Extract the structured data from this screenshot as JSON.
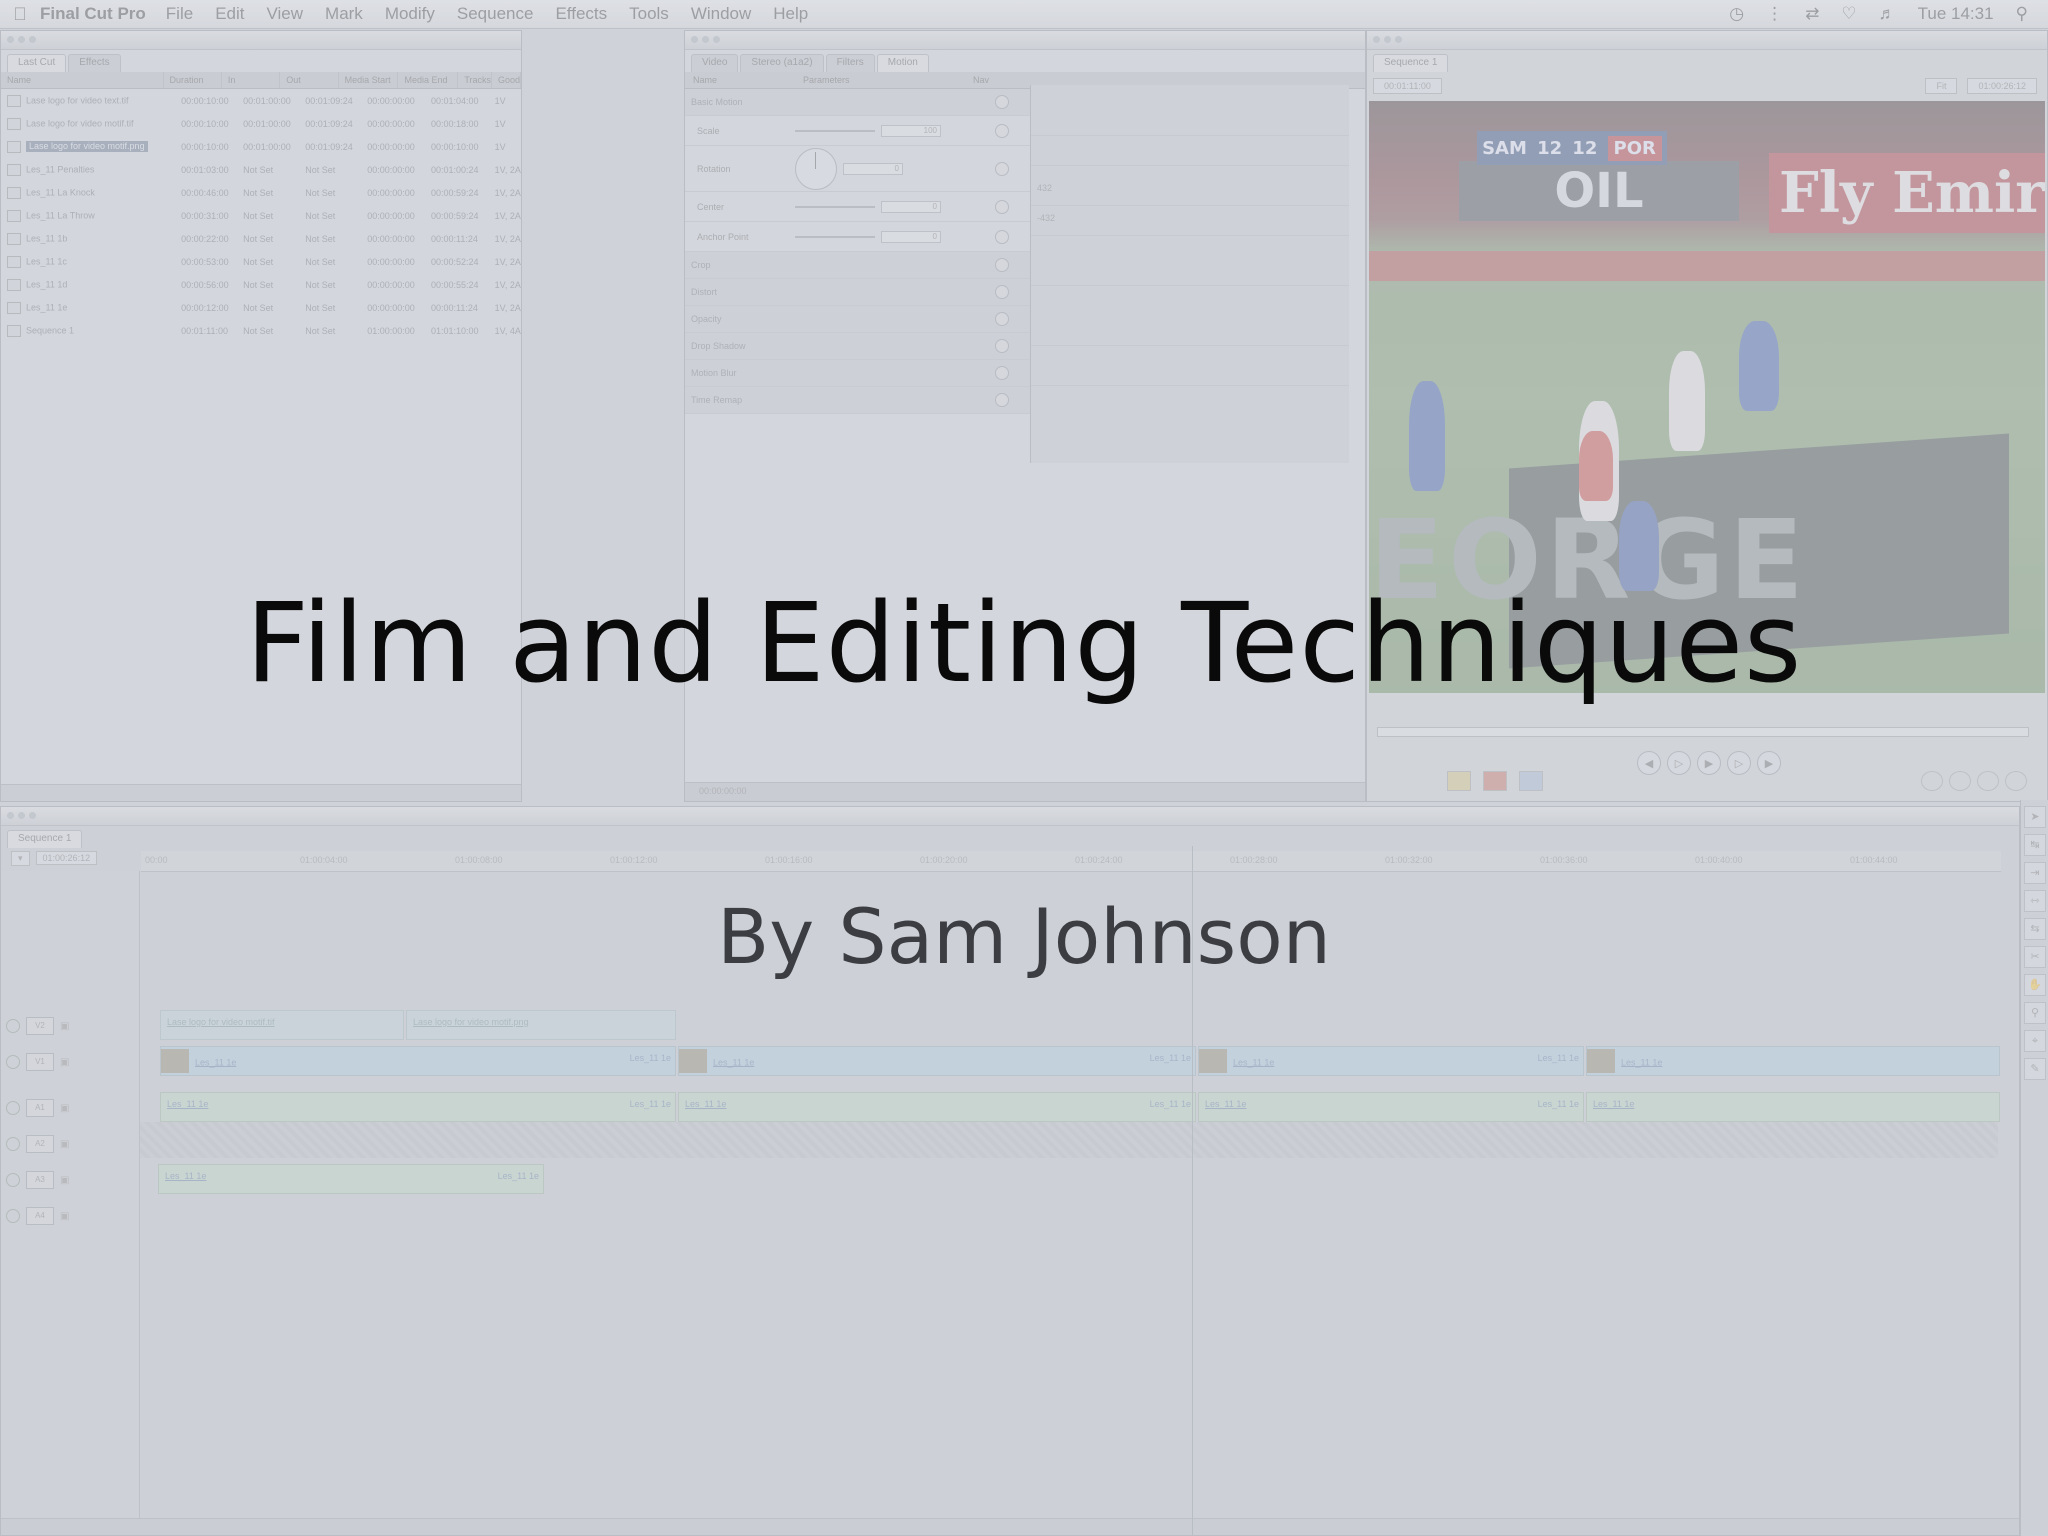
{
  "menubar": {
    "app_name": "Final Cut Pro",
    "items": [
      "File",
      "Edit",
      "View",
      "Mark",
      "Modify",
      "Sequence",
      "Effects",
      "Tools",
      "Window",
      "Help"
    ],
    "clock": "Tue 14:31"
  },
  "slide": {
    "title": "Film and Editing Techniques",
    "subtitle": "By Sam Johnson"
  },
  "browser": {
    "tabs": [
      "Last Cut",
      "Effects"
    ],
    "columns": [
      "Name",
      "Duration",
      "In",
      "Out",
      "Media Start",
      "Media End",
      "Tracks",
      "Good"
    ],
    "rows": [
      {
        "name": "Lase logo for video text.tif",
        "duration": "00:00:10:00",
        "in": "00:01:00:00",
        "out": "00:01:09:24",
        "media_start": "00:00:00:00",
        "media_end": "00:01:04:00",
        "tracks": "1V"
      },
      {
        "name": "Lase logo for video motif.tif",
        "duration": "00:00:10:00",
        "in": "00:01:00:00",
        "out": "00:01:09:24",
        "media_start": "00:00:00:00",
        "media_end": "00:00:18:00",
        "tracks": "1V"
      },
      {
        "name": "Lase logo for video motif.png",
        "duration": "00:00:10:00",
        "in": "00:01:00:00",
        "out": "00:01:09:24",
        "media_start": "00:00:00:00",
        "media_end": "00:00:10:00",
        "tracks": "1V",
        "selected": true
      },
      {
        "name": "Les_11 Penalties",
        "duration": "00:01:03:00",
        "in": "Not Set",
        "out": "Not Set",
        "media_start": "00:00:00:00",
        "media_end": "00:01:00:24",
        "tracks": "1V, 2A"
      },
      {
        "name": "Les_11 La Knock",
        "duration": "00:00:46:00",
        "in": "Not Set",
        "out": "Not Set",
        "media_start": "00:00:00:00",
        "media_end": "00:00:59:24",
        "tracks": "1V, 2A"
      },
      {
        "name": "Les_11 La Throw",
        "duration": "00:00:31:00",
        "in": "Not Set",
        "out": "Not Set",
        "media_start": "00:00:00:00",
        "media_end": "00:00:59:24",
        "tracks": "1V, 2A"
      },
      {
        "name": "Les_11 1b",
        "duration": "00:00:22:00",
        "in": "Not Set",
        "out": "Not Set",
        "media_start": "00:00:00:00",
        "media_end": "00:00:11:24",
        "tracks": "1V, 2A"
      },
      {
        "name": "Les_11 1c",
        "duration": "00:00:53:00",
        "in": "Not Set",
        "out": "Not Set",
        "media_start": "00:00:00:00",
        "media_end": "00:00:52:24",
        "tracks": "1V, 2A"
      },
      {
        "name": "Les_11 1d",
        "duration": "00:00:56:00",
        "in": "Not Set",
        "out": "Not Set",
        "media_start": "00:00:00:00",
        "media_end": "00:00:55:24",
        "tracks": "1V, 2A"
      },
      {
        "name": "Les_11 1e",
        "duration": "00:00:12:00",
        "in": "Not Set",
        "out": "Not Set",
        "media_start": "00:00:00:00",
        "media_end": "00:00:11:24",
        "tracks": "1V, 2A"
      },
      {
        "name": "Sequence 1",
        "duration": "00:01:11:00",
        "in": "Not Set",
        "out": "Not Set",
        "media_start": "01:00:00:00",
        "media_end": "01:01:10:00",
        "tracks": "1V, 4A"
      }
    ]
  },
  "viewer": {
    "tabs": [
      "Video",
      "Stereo (a1a2)",
      "Filters",
      "Motion"
    ],
    "columns": [
      "Name",
      "Parameters",
      "Nav"
    ],
    "params": [
      {
        "name": "Basic Motion",
        "section": true
      },
      {
        "name": "Scale",
        "value": "100"
      },
      {
        "name": "Rotation",
        "value": "0"
      },
      {
        "name": "Center",
        "value": "0"
      },
      {
        "name": "Anchor Point",
        "value": "0"
      },
      {
        "name": "Crop",
        "section": true
      },
      {
        "name": "Distort",
        "section": true
      },
      {
        "name": "Opacity",
        "section": true
      },
      {
        "name": "Drop Shadow",
        "section": true
      },
      {
        "name": "Motion Blur",
        "section": true
      },
      {
        "name": "Time Remap",
        "section": true
      }
    ],
    "graph_labels": [
      "432",
      "-432"
    ],
    "timecode": "00:00:00:00"
  },
  "canvas": {
    "tab": "Sequence 1",
    "timecode_left": "00:01:11:00",
    "timecode_right": "01:00:26:12",
    "zoom": "Fit",
    "scoreboard": {
      "team1": "SAM",
      "score1": "12",
      "score2": "12",
      "team2": "POR"
    },
    "ad_left": "OIL",
    "ad_right": "Fly Emirates",
    "board_text": "EORGE"
  },
  "timeline": {
    "tab": "Sequence 1",
    "timecode": "01:00:26:12",
    "ruler": [
      "00:00",
      "01:00:04:00",
      "01:00:08:00",
      "01:00:12:00",
      "01:00:16:00",
      "01:00:20:00",
      "01:00:24:00",
      "01:00:28:00",
      "01:00:32:00",
      "01:00:36:00",
      "01:00:40:00",
      "01:00:44:00"
    ],
    "tracks": [
      "V2",
      "V1",
      "A1",
      "A2",
      "A3",
      "A4"
    ],
    "v2_clips": [
      "Lase logo for video motif.tif",
      "Lase logo for video motif.png"
    ],
    "v1_clip": "Les_11 1e",
    "a1_clip": "Les_11 1e",
    "a3_clip": "Les_11 1e"
  }
}
